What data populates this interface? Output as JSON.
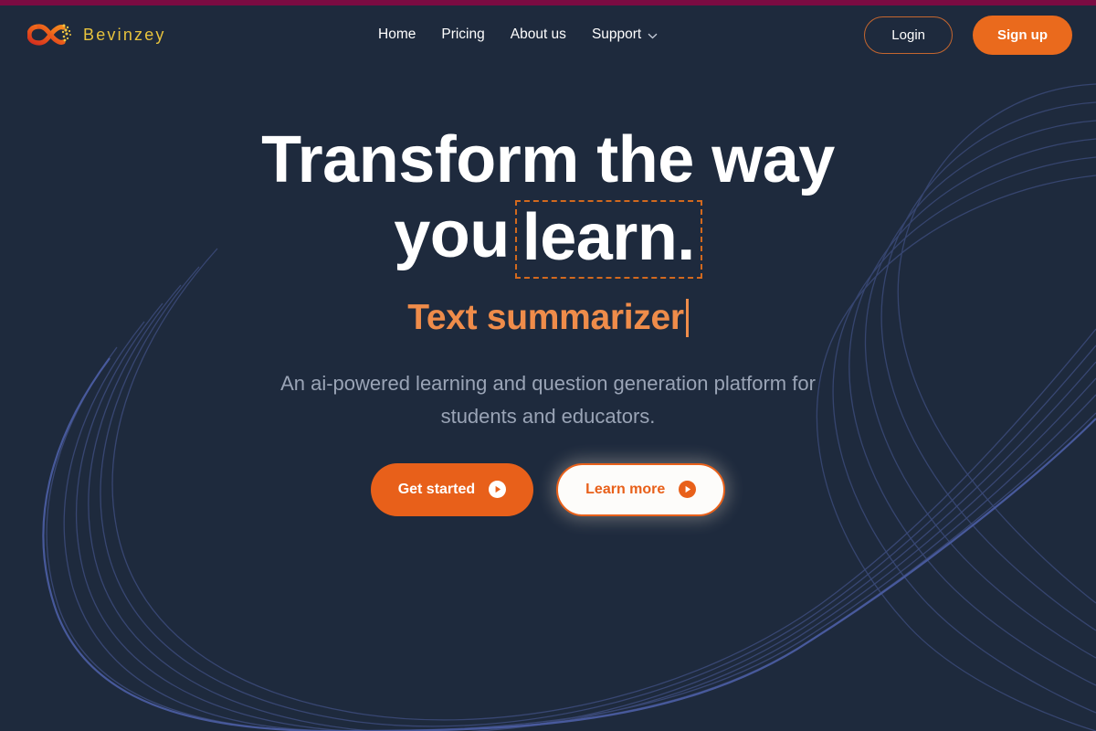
{
  "brand": {
    "name": "Bevinzey",
    "logo_icon": "infinity-logo-icon",
    "name_color": "#e8c33d",
    "logo_color": "#ea5a1c"
  },
  "theme": {
    "background": "#1e2a3d",
    "accent_orange": "#e8601a",
    "accent_orange_light": "#ef8c4a",
    "top_strip": "#7b0b42",
    "muted_text": "#9aa4b6",
    "deco_line": "#3b4a78"
  },
  "nav": {
    "items": [
      {
        "label": "Home",
        "has_dropdown": false
      },
      {
        "label": "Pricing",
        "has_dropdown": false
      },
      {
        "label": "About us",
        "has_dropdown": false
      },
      {
        "label": "Support",
        "has_dropdown": true,
        "dropdown_icon": "chevron-down-icon"
      }
    ]
  },
  "auth": {
    "login_label": "Login",
    "signup_label": "Sign up"
  },
  "hero": {
    "headline_line1": "Transform the way",
    "headline_line2_prefix": "you",
    "headline_line2_boxed": "learn.",
    "typed_text": "Text summarizer",
    "caret": "|",
    "description_line1": "An ai-powered learning and question generation",
    "description_line2": "platform for students and educators.",
    "primary_cta": {
      "label": "Get started",
      "icon": "play-circle-icon"
    },
    "secondary_cta": {
      "label": "Learn more",
      "icon": "play-circle-icon"
    }
  }
}
